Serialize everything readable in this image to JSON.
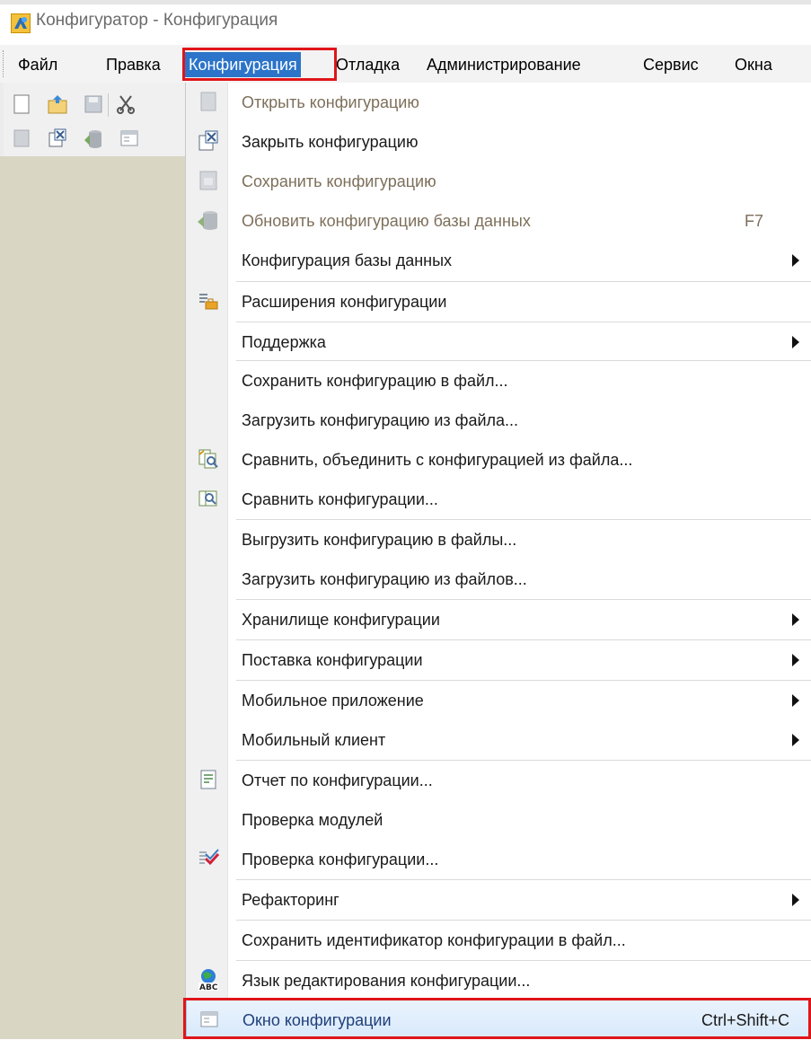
{
  "window": {
    "title": "Конфигуратор - Конфигурация",
    "app_icon": "1c-configurator-icon"
  },
  "menubar": {
    "items": [
      {
        "label": "Файл",
        "name": "menu-file"
      },
      {
        "label": "Правка",
        "name": "menu-edit"
      },
      {
        "label": "Конфигурация",
        "name": "menu-configuration",
        "active": true
      },
      {
        "label": "Отладка",
        "name": "menu-debug"
      },
      {
        "label": "Администрирование",
        "name": "menu-administration"
      },
      {
        "label": "Сервис",
        "name": "menu-service"
      },
      {
        "label": "Окна",
        "name": "menu-windows"
      }
    ]
  },
  "toolbar": {
    "row1": [
      "new-document-icon",
      "open-icon",
      "save-icon",
      "cut-icon"
    ],
    "row2": [
      "open-config-icon",
      "close-config-icon",
      "update-db-icon",
      "config-window-icon"
    ]
  },
  "dropdown": {
    "items": [
      {
        "label": "Открыть конфигурацию",
        "disabled": true,
        "icon": "open-config-icon"
      },
      {
        "label": "Закрыть конфигурацию",
        "icon": "close-config-icon"
      },
      {
        "label": "Сохранить конфигурацию",
        "disabled": true,
        "icon": "save-config-icon"
      },
      {
        "label": "Обновить конфигурацию базы данных",
        "disabled": true,
        "icon": "update-db-icon",
        "shortcut": "F7"
      },
      {
        "label": "Конфигурация базы данных",
        "submenu": true
      },
      {
        "label": "Расширения конфигурации",
        "icon": "extensions-icon"
      },
      {
        "label": "Поддержка",
        "submenu": true
      },
      {
        "label": "Сохранить конфигурацию в файл..."
      },
      {
        "label": "Загрузить конфигурацию из файла..."
      },
      {
        "label": "Сравнить, объединить с конфигурацией из файла...",
        "icon": "compare-merge-icon"
      },
      {
        "label": "Сравнить конфигурации...",
        "icon": "compare-icon"
      },
      {
        "label": "Выгрузить конфигурацию в файлы..."
      },
      {
        "label": "Загрузить конфигурацию из файлов..."
      },
      {
        "label": "Хранилище конфигурации",
        "submenu": true
      },
      {
        "label": "Поставка конфигурации",
        "submenu": true
      },
      {
        "label": "Мобильное приложение",
        "submenu": true
      },
      {
        "label": "Мобильный клиент",
        "submenu": true
      },
      {
        "label": "Отчет по конфигурации...",
        "icon": "report-icon"
      },
      {
        "label": "Проверка модулей"
      },
      {
        "label": "Проверка конфигурации...",
        "icon": "check-config-icon"
      },
      {
        "label": "Рефакторинг",
        "submenu": true
      },
      {
        "label": "Сохранить идентификатор конфигурации в файл..."
      },
      {
        "label": "Язык редактирования конфигурации...",
        "icon": "language-abc-icon"
      },
      {
        "label": "Окно конфигурации",
        "icon": "config-window-icon",
        "shortcut": "Ctrl+Shift+C",
        "hover": true
      }
    ]
  },
  "colors": {
    "highlight": "#e0151a",
    "menu_active": "#2b74c9",
    "disabled_text": "#7d6f5a"
  }
}
